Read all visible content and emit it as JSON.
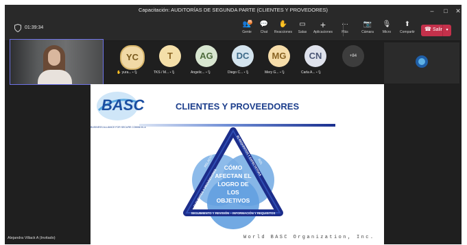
{
  "window": {
    "title": "Capacitación: AUDITORÍAS DE SEGUNDA PARTE (CLIENTES Y PROVEDORES)",
    "controls": [
      "–",
      "□",
      "✕"
    ]
  },
  "toolbar": {
    "timer": "01:39:34",
    "items": [
      {
        "label": "Gente",
        "icon": "people-icon",
        "glyph": "👥",
        "badge": "86"
      },
      {
        "label": "Chat",
        "icon": "chat-icon",
        "glyph": "💬"
      },
      {
        "label": "Reacciones",
        "icon": "reactions-icon",
        "glyph": "✋"
      },
      {
        "label": "Salas",
        "icon": "rooms-icon",
        "glyph": "▭"
      },
      {
        "label": "Aplicaciones",
        "icon": "apps-icon",
        "glyph": "+"
      },
      {
        "label": "Más",
        "icon": "more-icon",
        "glyph": "···"
      },
      {
        "label": "Cámara",
        "icon": "camera-icon",
        "glyph": "📷"
      },
      {
        "label": "Micro",
        "icon": "mic-icon",
        "glyph": "🎙"
      },
      {
        "label": "Compartir",
        "icon": "share-icon",
        "glyph": "⬆"
      }
    ],
    "leave_label": "Salir"
  },
  "participants": [
    {
      "initials": "YC",
      "name": "yura...",
      "bg": "#f1d9a6",
      "fg": "#7a5a1e",
      "hand": true
    },
    {
      "initials": "T",
      "name": "TKS / M...",
      "bg": "#f4dfa9",
      "fg": "#8a6422"
    },
    {
      "initials": "AG",
      "name": "Angelic...",
      "bg": "#d8e6d0",
      "fg": "#4d6b3c"
    },
    {
      "initials": "DC",
      "name": "Diego C...",
      "bg": "#d4e4ee",
      "fg": "#3d6a88"
    },
    {
      "initials": "MG",
      "name": "Mery G...",
      "bg": "#f6ddaa",
      "fg": "#8a6322"
    },
    {
      "initials": "CN",
      "name": "Carla A...",
      "bg": "#dfe2ec",
      "fg": "#4b5675"
    }
  ],
  "more_participants": "+84",
  "presenter": {
    "name": "Alejandra Villack A (Invitado)"
  },
  "slide": {
    "title": "CLIENTES Y PROVEEDORES",
    "logo_text": "BASC",
    "logo_tagline": "BUSINESS ALLIANCE FOR SECURE COMMERCE",
    "footer": "World BASC Organization, Inc.",
    "diagram": {
      "center": [
        "CÓMO",
        "AFECTAN EL",
        "LOGRO DE",
        "LOS",
        "OBJETIVOS"
      ],
      "left_side": "A) CLIENTES Y PROVEEDORES",
      "right_side": "B) REQUISITOS Y EXPECTATIVAS",
      "bottom_side": "SEGUIMIENTO Y REVISIÓN – INFORMACIÓN Y REQUISITOS",
      "left_outer": "RELACIÓN",
      "right_outer": "ROL"
    }
  }
}
